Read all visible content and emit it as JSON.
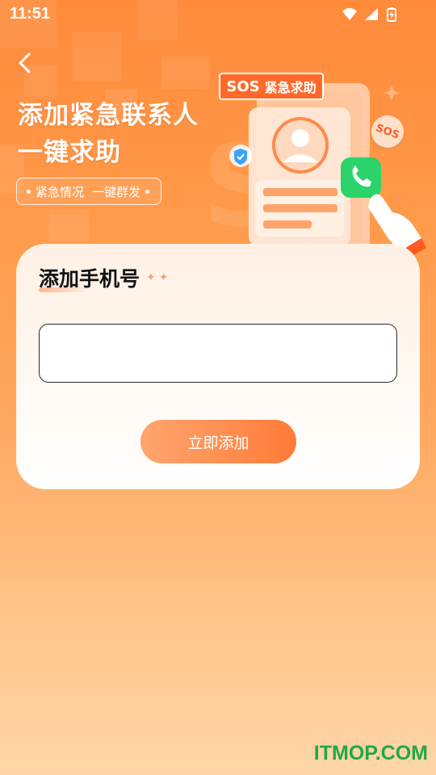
{
  "status_bar": {
    "time": "11:51",
    "icons": [
      "wifi-icon",
      "cell-signal-icon",
      "battery-charging-icon"
    ]
  },
  "nav": {
    "back_icon": "chevron-left-icon"
  },
  "hero": {
    "title_line1": "添加紧急联系人",
    "title_line2": "一键求助",
    "tag_part1": "紧急情况",
    "tag_part2": "一键群发"
  },
  "illustration": {
    "banner_sos": "SOS",
    "banner_text": "紧急求助",
    "badge_text": "SOS"
  },
  "form": {
    "title": "添加手机号",
    "phone_value": "",
    "phone_placeholder": "",
    "submit_label": "立即添加"
  },
  "watermark": {
    "text": "ITMOP.COM"
  },
  "colors": {
    "accent": "#ff7a38",
    "button_start": "#ffa66e",
    "banner": "#ff6a2a",
    "phone_green": "#2bd36a",
    "watermark": "#1fa84a"
  }
}
